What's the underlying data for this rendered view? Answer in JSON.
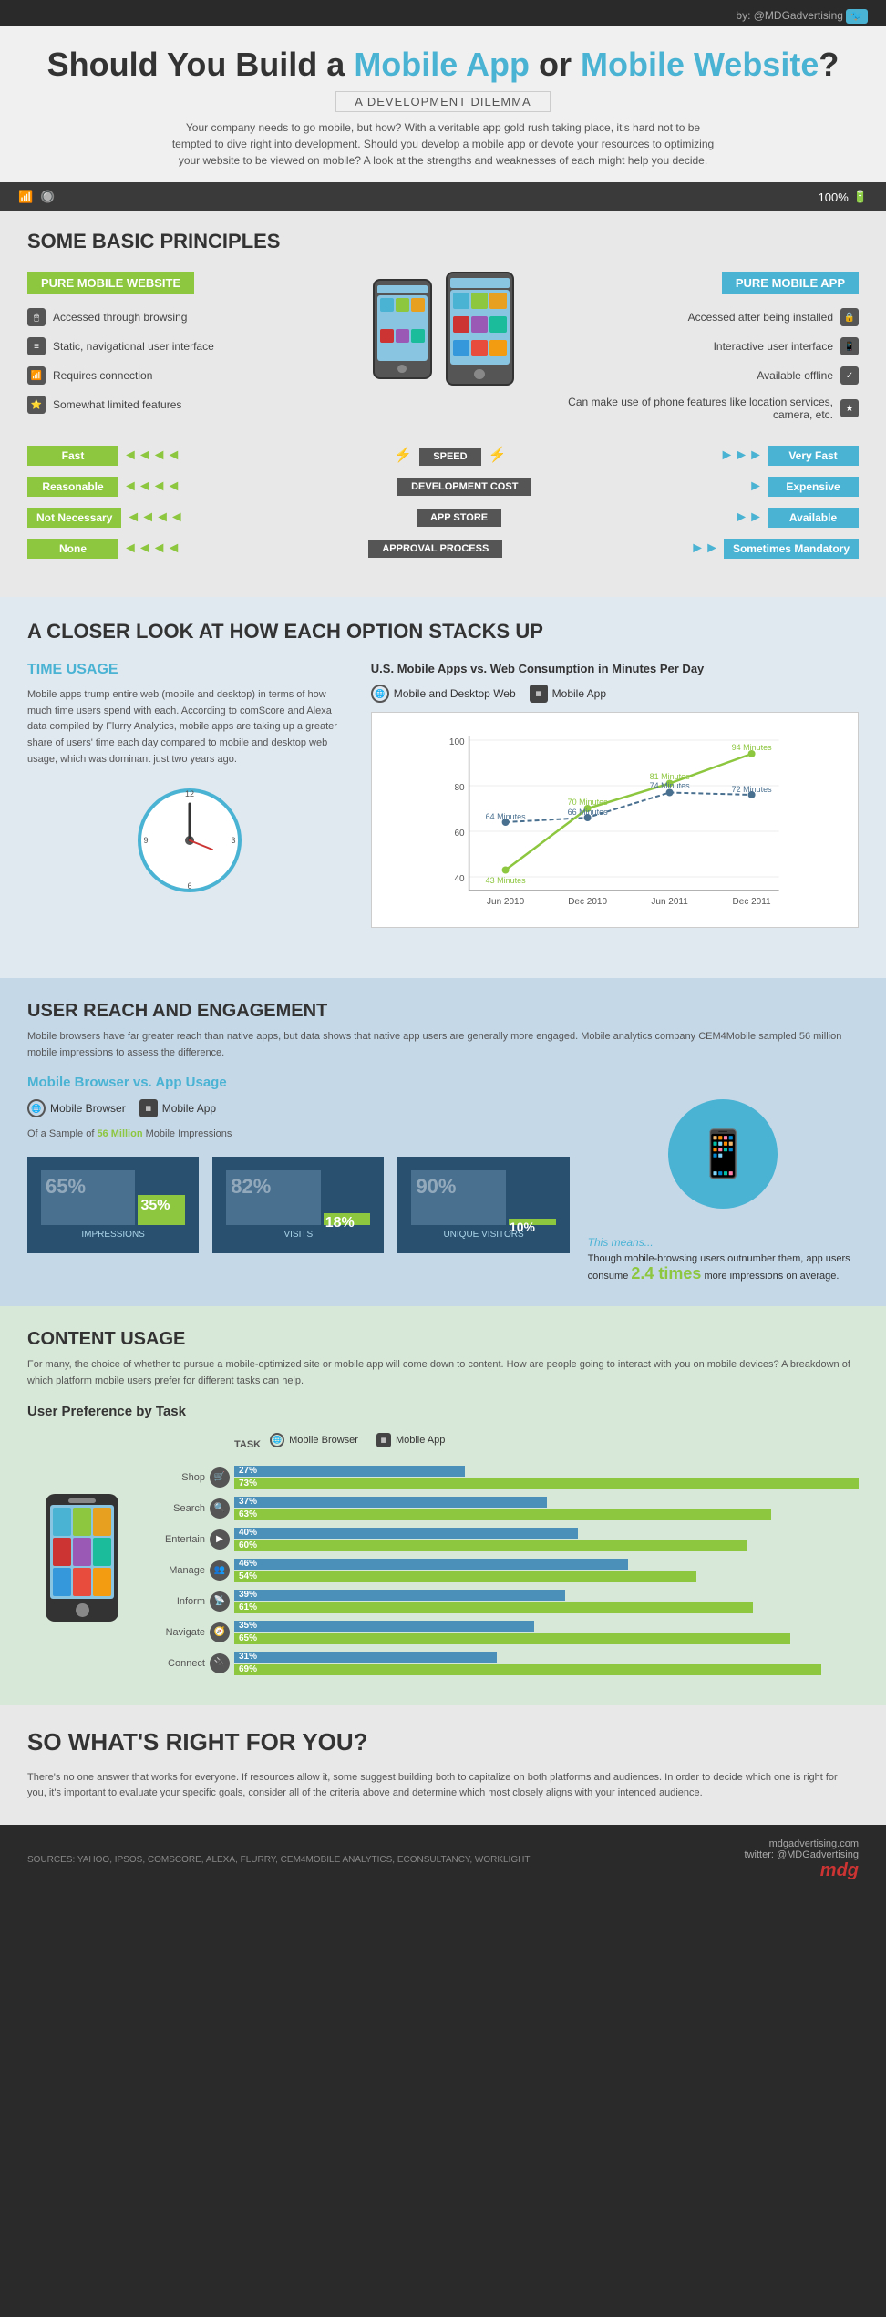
{
  "header": {
    "byline": "by: @MDGadvertising",
    "twitter_icon": "🐦"
  },
  "title": {
    "main": "Should You Build a Mobile App or Mobile Website?",
    "subtitle": "A DEVELOPMENT DILEMMA",
    "description": "Your company needs to go mobile, but how? With a veritable app gold rush taking place, it's hard not to be tempted to dive right into development. Should you develop a mobile app or devote your resources to optimizing your website to be viewed on mobile? A look at the strengths and weaknesses of each might help you decide."
  },
  "status_bar": {
    "signal_bars": "▌▌▌▌",
    "wifi": "WiFi",
    "battery": "100%"
  },
  "principles": {
    "title": "SOME BASIC PRINCIPLES",
    "left_header": "PURE MOBILE WEBSITE",
    "right_header": "PURE MOBILE APP",
    "left_features": [
      {
        "icon": "🖱",
        "text": "Accessed through browsing"
      },
      {
        "icon": "≡",
        "text": "Static, navigational user interface"
      },
      {
        "icon": "📶",
        "text": "Requires connection"
      },
      {
        "icon": "⭐",
        "text": "Somewhat limited features"
      }
    ],
    "right_features": [
      {
        "icon": "🔒",
        "text": "Accessed after being installed"
      },
      {
        "icon": "📱",
        "text": "Interactive user interface"
      },
      {
        "icon": "✓",
        "text": "Available offline"
      },
      {
        "icon": "★",
        "text": "Can make use of phone features like location services, camera, etc."
      }
    ],
    "comparisons": [
      {
        "left": "Fast",
        "center": "SPEED",
        "right": "Very Fast",
        "icon": "⚡"
      },
      {
        "left": "Reasonable",
        "center": "DEVELOPMENT COST",
        "right": "Expensive",
        "icon": "💰"
      },
      {
        "left": "Not Necessary",
        "center": "APP STORE",
        "right": "Available",
        "icon": "🛒"
      },
      {
        "left": "None",
        "center": "APPROVAL PROCESS",
        "right": "Sometimes Mandatory",
        "icon": "✅"
      }
    ]
  },
  "closer_look": {
    "title": "A CLOSER LOOK AT HOW EACH OPTION STACKS UP",
    "time_usage": {
      "subtitle": "TIME USAGE",
      "description": "Mobile apps trump entire web (mobile and desktop) in terms of how much time users spend with each. According to comScore and Alexa data compiled by Flurry Analytics, mobile apps are taking up a greater share of users' time each day compared to mobile and desktop web usage, which was dominant just two years ago."
    },
    "chart": {
      "title": "U.S. Mobile Apps vs. Web Consumption in Minutes Per Day",
      "legend": {
        "web": "Mobile and Desktop Web",
        "app": "Mobile App"
      },
      "y_labels": [
        "40",
        "60",
        "80",
        "100"
      ],
      "x_labels": [
        "Jun 2010",
        "Dec 2010",
        "Jun 2011",
        "Dec 2011"
      ],
      "web_data": [
        64,
        66,
        74,
        72
      ],
      "app_data": [
        43,
        70,
        81,
        94
      ]
    }
  },
  "user_reach": {
    "title": "USER REACH AND ENGAGEMENT",
    "description": "Mobile browsers have far greater reach than native apps, but data shows that native app users are generally more engaged. Mobile analytics company CEM4Mobile sampled 56 million mobile impressions to assess the difference.",
    "subtitle": "Mobile Browser vs. App Usage",
    "sample_note": "Of a Sample of 56 Million Mobile Impressions",
    "stats": [
      {
        "label": "IMPRESSIONS",
        "bg_pct": "65%",
        "fg_pct": "35%"
      },
      {
        "label": "VISITS",
        "bg_pct": "82%",
        "fg_pct": "18%"
      },
      {
        "label": "UNIQUE VISITORS",
        "bg_pct": "90%",
        "fg_pct": "10%"
      }
    ],
    "means_title": "This means...",
    "means_text": "Though mobile-browsing users outnumber them, app users consume",
    "means_highlight": "2.4 times",
    "means_text2": "more impressions on average."
  },
  "content_usage": {
    "title": "CONTENT USAGE",
    "description": "For many, the choice of whether to pursue a mobile-optimized site or mobile app will come down to content. How are people going to interact with you on mobile devices? A breakdown of which platform mobile users prefer for different tasks can help.",
    "subtitle": "User Preference by Task",
    "task_label": "TASK",
    "legend_web": "Mobile Browser",
    "legend_app": "Mobile App",
    "tasks": [
      {
        "name": "Shop",
        "icon": "🛒",
        "web_pct": 27,
        "app_pct": 73
      },
      {
        "name": "Search",
        "icon": "🔍",
        "web_pct": 37,
        "app_pct": 63
      },
      {
        "name": "Entertain",
        "icon": "▶",
        "web_pct": 40,
        "app_pct": 60
      },
      {
        "name": "Manage",
        "icon": "👥",
        "web_pct": 46,
        "app_pct": 54
      },
      {
        "name": "Inform",
        "icon": "📡",
        "web_pct": 39,
        "app_pct": 61
      },
      {
        "name": "Navigate",
        "icon": "🧭",
        "web_pct": 35,
        "app_pct": 65
      },
      {
        "name": "Connect",
        "icon": "🔌",
        "web_pct": 31,
        "app_pct": 69
      }
    ]
  },
  "conclusion": {
    "title": "SO WHAT'S RIGHT FOR YOU?",
    "text": "There's no one answer that works for everyone. If resources allow it, some suggest building both to capitalize on both platforms and audiences. In order to decide which one is right for you, it's important to evaluate your specific goals, consider all of the criteria above and determine which most closely aligns with your intended audience."
  },
  "footer": {
    "sources": "SOURCES: YAHOO, IPSOS, COMSCORE, ALEXA, FLURRY, CEM4MOBILE ANALYTICS, ECONSULTANCY, WORKLIGHT",
    "website": "mdgadvertising.com",
    "twitter": "twitter: @MDGadvertising",
    "logo": "mdg"
  }
}
